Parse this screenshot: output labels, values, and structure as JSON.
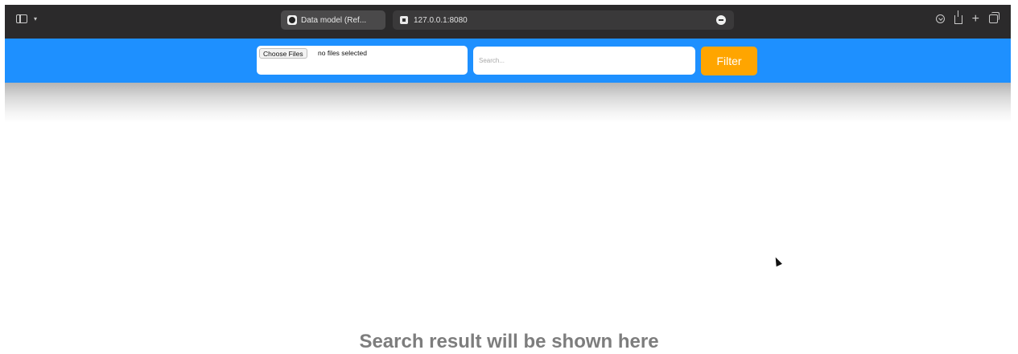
{
  "browser": {
    "tab_title": "Data model (Ref...",
    "url": "127.0.0.1:8080"
  },
  "header": {
    "choose_files_label": "Choose Files",
    "file_status": "no files selected",
    "search_placeholder": "Search...",
    "filter_label": "Filter"
  },
  "main": {
    "result_message": "Search result will be shown here"
  },
  "colors": {
    "header_bg": "#1e90ff",
    "filter_bg": "#ffa500",
    "chrome_bg": "#2b2a2b"
  }
}
